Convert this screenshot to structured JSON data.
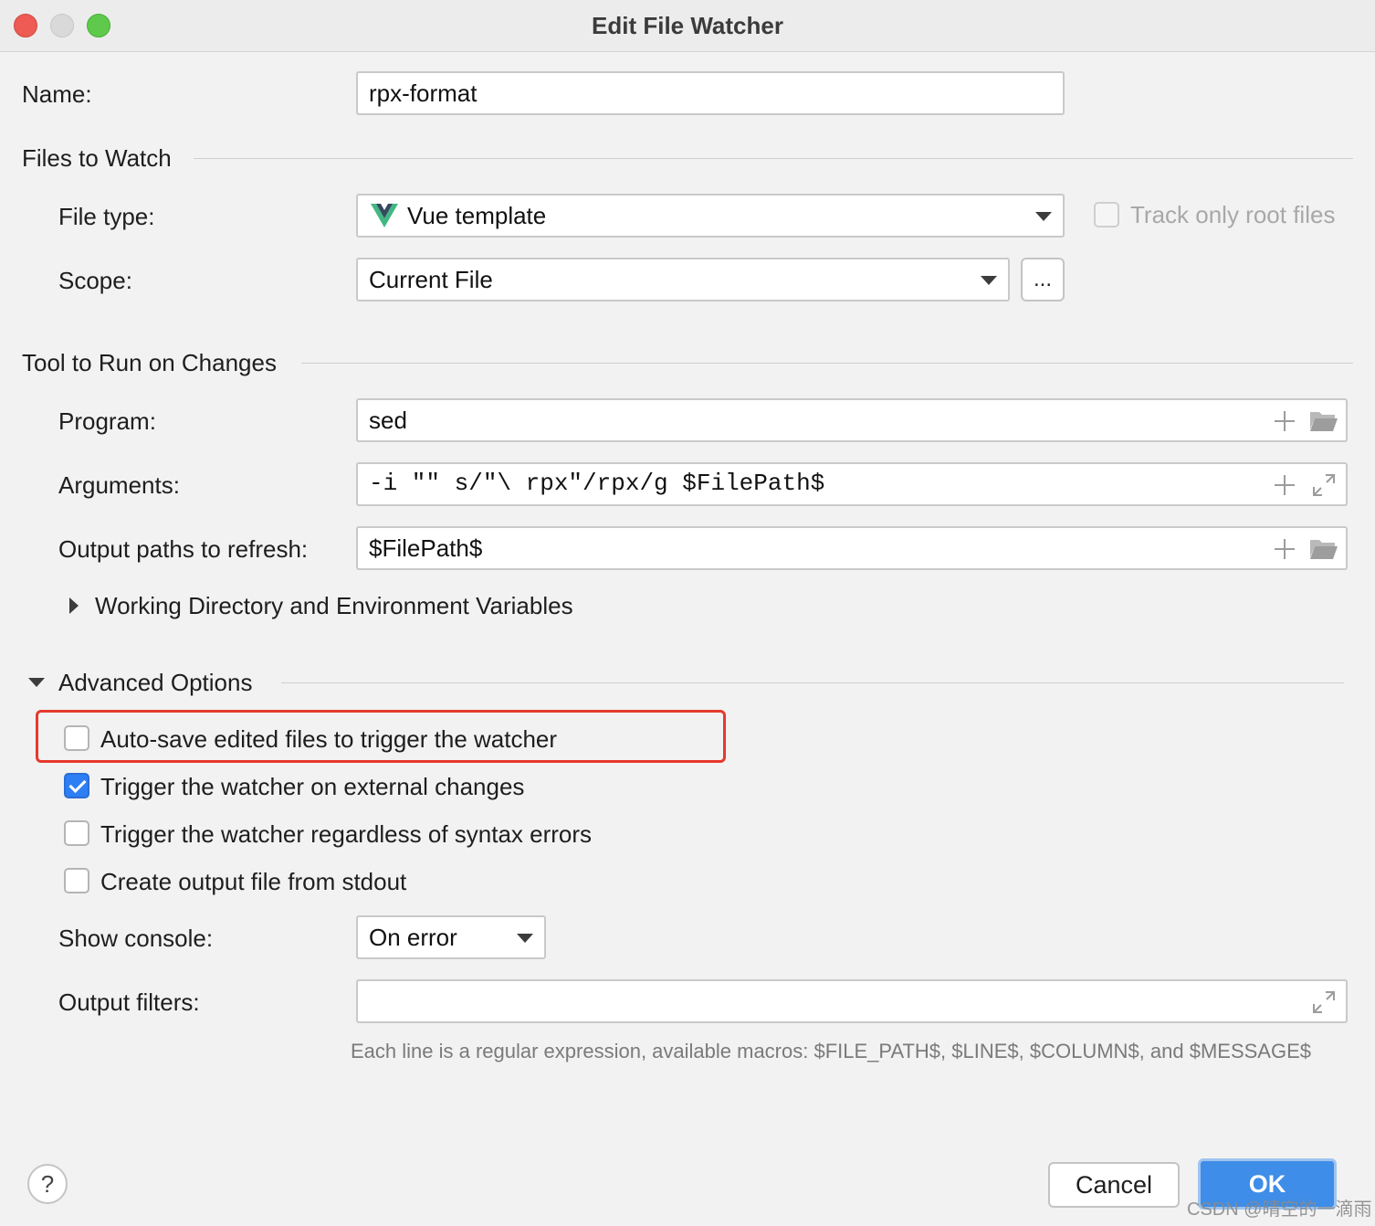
{
  "window": {
    "title": "Edit File Watcher"
  },
  "name": {
    "label": "Name:",
    "value": "rpx-format"
  },
  "files_to_watch": {
    "section_label": "Files to Watch",
    "file_type_label": "File type:",
    "file_type_value": "Vue template",
    "file_type_icon": "vue-logo-icon",
    "track_root_label": "Track only root files",
    "track_root_checked": false,
    "scope_label": "Scope:",
    "scope_value": "Current File",
    "scope_more_label": "..."
  },
  "tool": {
    "section_label": "Tool to Run on Changes",
    "program_label": "Program:",
    "program_value": "sed",
    "arguments_label": "Arguments:",
    "arguments_value": "-i \"\" s/\"\\ rpx\"/rpx/g $FilePath$",
    "output_paths_label": "Output paths to refresh:",
    "output_paths_value": "$FilePath$",
    "working_dir_label": "Working Directory and Environment Variables"
  },
  "advanced": {
    "section_label": "Advanced Options",
    "options": [
      {
        "label": "Auto-save edited files to trigger the watcher",
        "checked": false
      },
      {
        "label": "Trigger the watcher on external changes",
        "checked": true
      },
      {
        "label": "Trigger the watcher regardless of syntax errors",
        "checked": false
      },
      {
        "label": "Create output file from stdout",
        "checked": false
      }
    ],
    "show_console_label": "Show console:",
    "show_console_value": "On error",
    "output_filters_label": "Output filters:",
    "output_filters_value": "",
    "hint": "Each line is a regular expression, available macros: $FILE_PATH$, $LINE$, $COLUMN$, and $MESSAGE$"
  },
  "buttons": {
    "help_label": "?",
    "cancel_label": "Cancel",
    "ok_label": "OK"
  },
  "watermark": "CSDN @晴空的一滴雨",
  "colors": {
    "accent": "#3e8de8",
    "highlight_box": "#e6392d",
    "vue_green": "#41b883",
    "vue_dark": "#35495e"
  }
}
